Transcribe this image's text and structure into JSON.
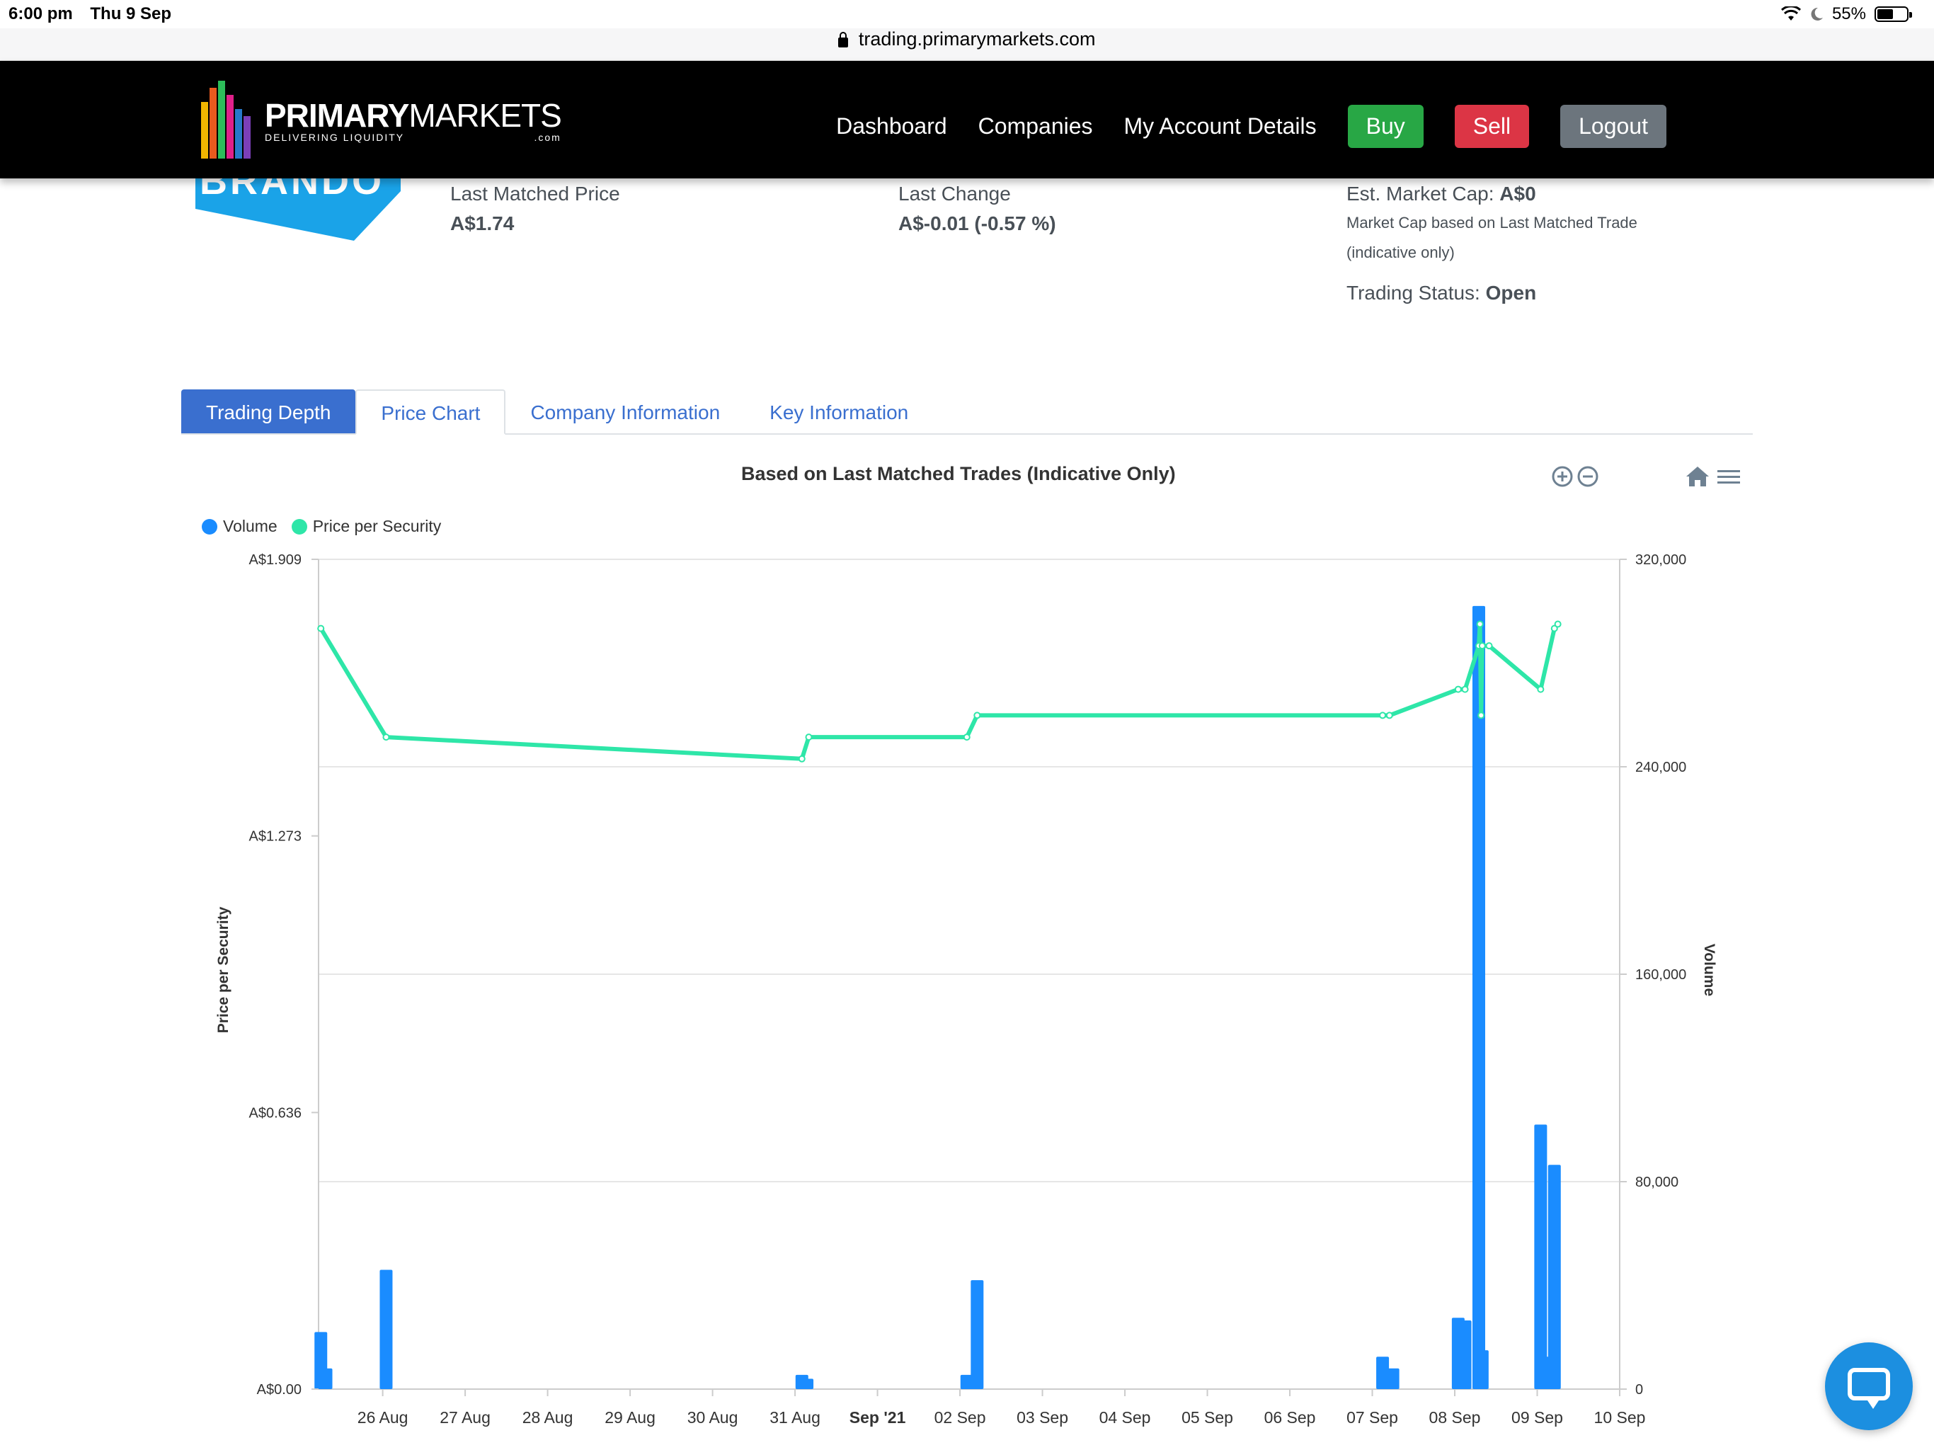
{
  "status_bar": {
    "time": "6:00 pm",
    "date": "Thu 9 Sep",
    "battery": "55%",
    "battery_level": 0.55
  },
  "browser": {
    "url": "trading.primarymarkets.com"
  },
  "navbar": {
    "logo_primary": "PRIMARY",
    "logo_markets": "MARKETS",
    "logo_tagline": "DELIVERING LIQUIDITY",
    "logo_domain": ".com",
    "links": [
      "Dashboard",
      "Companies",
      "My Account Details"
    ],
    "buy_label": "Buy",
    "sell_label": "Sell",
    "logout_label": "Logout",
    "colors": {
      "buy": "#28a745",
      "sell": "#dc3545",
      "logout": "#6c757d"
    }
  },
  "company": {
    "logo_text": "BRANDO",
    "last_matched_price_label": "Last Matched Price",
    "last_matched_price": "A$1.74",
    "last_change_label": "Last Change",
    "last_change": "A$-0.01 (-0.57 %)",
    "market_cap_label": "Est. Market Cap:",
    "market_cap": "A$0",
    "market_cap_note_1": "Market Cap based on Last Matched Trade",
    "market_cap_note_2": "(indicative only)",
    "trading_status_label": "Trading Status:",
    "trading_status": "Open"
  },
  "tabs": [
    {
      "label": "Trading Depth",
      "active": true
    },
    {
      "label": "Price Chart",
      "active": false
    },
    {
      "label": "Company Information",
      "active": false
    },
    {
      "label": "Key Information",
      "active": false
    }
  ],
  "chart_data": {
    "type": "line+bar",
    "title": "Based on Last Matched Trades (Indicative Only)",
    "legend": [
      "Volume",
      "Price per Security"
    ],
    "legend_placement": "top-left",
    "y_left_label": "Price per Security",
    "y_right_label": "Volume",
    "y_left_ticks": [
      "A$1.909",
      "A$1.273",
      "A$0.636",
      "A$0.00"
    ],
    "y_left_range": [
      0,
      1.909
    ],
    "y_right_ticks": [
      "320,000",
      "240,000",
      "160,000",
      "80,000",
      "0"
    ],
    "y_right_range": [
      0,
      320000
    ],
    "x_ticks": [
      "26 Aug",
      "27 Aug",
      "28 Aug",
      "29 Aug",
      "30 Aug",
      "31 Aug",
      "Sep '21",
      "02 Sep",
      "03 Sep",
      "04 Sep",
      "05 Sep",
      "06 Sep",
      "07 Sep",
      "08 Sep",
      "09 Sep",
      "10 Sep"
    ],
    "x_range": [
      "2021-08-25T05:20",
      "2021-09-10T00:00"
    ],
    "colors": {
      "volume": "#1a8cff",
      "price": "#2ee6a8"
    },
    "price_series": [
      {
        "x": "2021-08-25T06:00",
        "y": 1.75
      },
      {
        "x": "2021-08-26T01:00",
        "y": 1.5
      },
      {
        "x": "2021-08-31T02:00",
        "y": 1.45
      },
      {
        "x": "2021-08-31T04:00",
        "y": 1.5
      },
      {
        "x": "2021-09-02T02:00",
        "y": 1.5
      },
      {
        "x": "2021-09-02T05:00",
        "y": 1.55
      },
      {
        "x": "2021-09-07T03:00",
        "y": 1.55
      },
      {
        "x": "2021-09-07T05:00",
        "y": 1.55
      },
      {
        "x": "2021-09-08T01:00",
        "y": 1.61
      },
      {
        "x": "2021-09-08T03:00",
        "y": 1.61
      },
      {
        "x": "2021-09-08T07:00",
        "y": 1.71
      },
      {
        "x": "2021-09-08T07:20",
        "y": 1.76
      },
      {
        "x": "2021-09-08T07:40",
        "y": 1.55
      },
      {
        "x": "2021-09-08T08:00",
        "y": 1.71
      },
      {
        "x": "2021-09-08T10:00",
        "y": 1.71
      },
      {
        "x": "2021-09-09T01:00",
        "y": 1.61
      },
      {
        "x": "2021-09-09T05:00",
        "y": 1.75
      },
      {
        "x": "2021-09-09T06:00",
        "y": 1.76
      }
    ],
    "volume_series": [
      {
        "x": "2021-08-25T06:00",
        "y": 22000
      },
      {
        "x": "2021-08-25T07:30",
        "y": 8000
      },
      {
        "x": "2021-08-26T01:00",
        "y": 46000
      },
      {
        "x": "2021-08-31T02:00",
        "y": 5500
      },
      {
        "x": "2021-08-31T03:30",
        "y": 4000
      },
      {
        "x": "2021-09-02T02:00",
        "y": 5500
      },
      {
        "x": "2021-09-02T05:00",
        "y": 42000
      },
      {
        "x": "2021-09-07T03:00",
        "y": 12500
      },
      {
        "x": "2021-09-07T06:00",
        "y": 8000
      },
      {
        "x": "2021-09-08T01:00",
        "y": 27500
      },
      {
        "x": "2021-09-08T03:00",
        "y": 26500
      },
      {
        "x": "2021-09-08T07:00",
        "y": 302000
      },
      {
        "x": "2021-09-08T08:00",
        "y": 15000
      },
      {
        "x": "2021-09-09T01:00",
        "y": 102000
      },
      {
        "x": "2021-09-09T04:00",
        "y": 12500
      },
      {
        "x": "2021-09-09T05:00",
        "y": 86500
      }
    ]
  }
}
